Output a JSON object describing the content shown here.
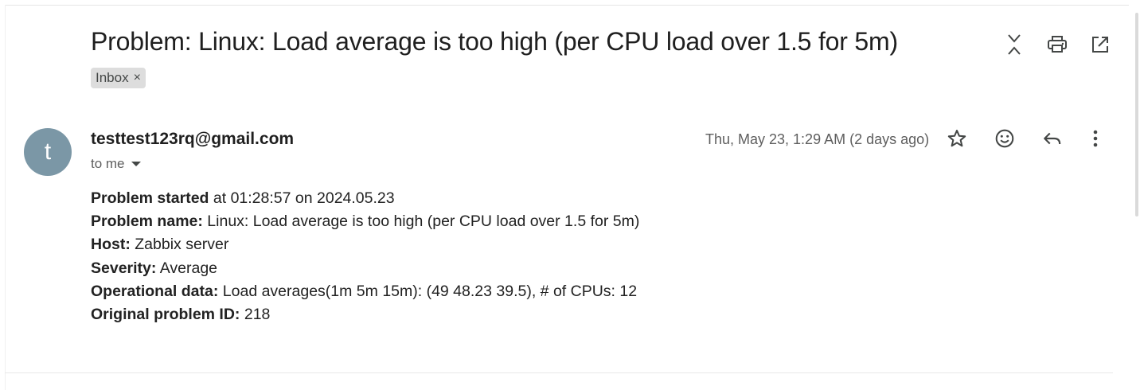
{
  "email": {
    "subject": "Problem: Linux: Load average is too high (per CPU load over 1.5 for 5m)",
    "labels": [
      {
        "name": "Inbox",
        "remove_glyph": "×"
      }
    ],
    "toolbar": {
      "icons": [
        "collapse-all-icon",
        "print-icon",
        "open-in-new-window-icon"
      ]
    },
    "sender": {
      "avatar_letter": "t",
      "avatar_color": "#7b97a6",
      "email": "testtest123rq@gmail.com",
      "recipient": "to me"
    },
    "date": "Thu, May 23, 1:29 AM (2 days ago)",
    "message_actions": {
      "icons": [
        "star-icon",
        "emoji-reaction-icon",
        "reply-icon",
        "more-vert-icon"
      ]
    },
    "body": [
      {
        "label": "Problem started",
        "value": " at 01:28:57 on 2024.05.23"
      },
      {
        "label": "Problem name:",
        "value": " Linux: Load average is too high (per CPU load over 1.5 for 5m)"
      },
      {
        "label": "Host:",
        "value": " Zabbix server"
      },
      {
        "label": "Severity:",
        "value": " Average"
      },
      {
        "label": "Operational data:",
        "value": " Load averages(1m 5m 15m): (49 48.23 39.5), # of CPUs: 12"
      },
      {
        "label": "Original problem ID:",
        "value": " 218"
      }
    ]
  }
}
